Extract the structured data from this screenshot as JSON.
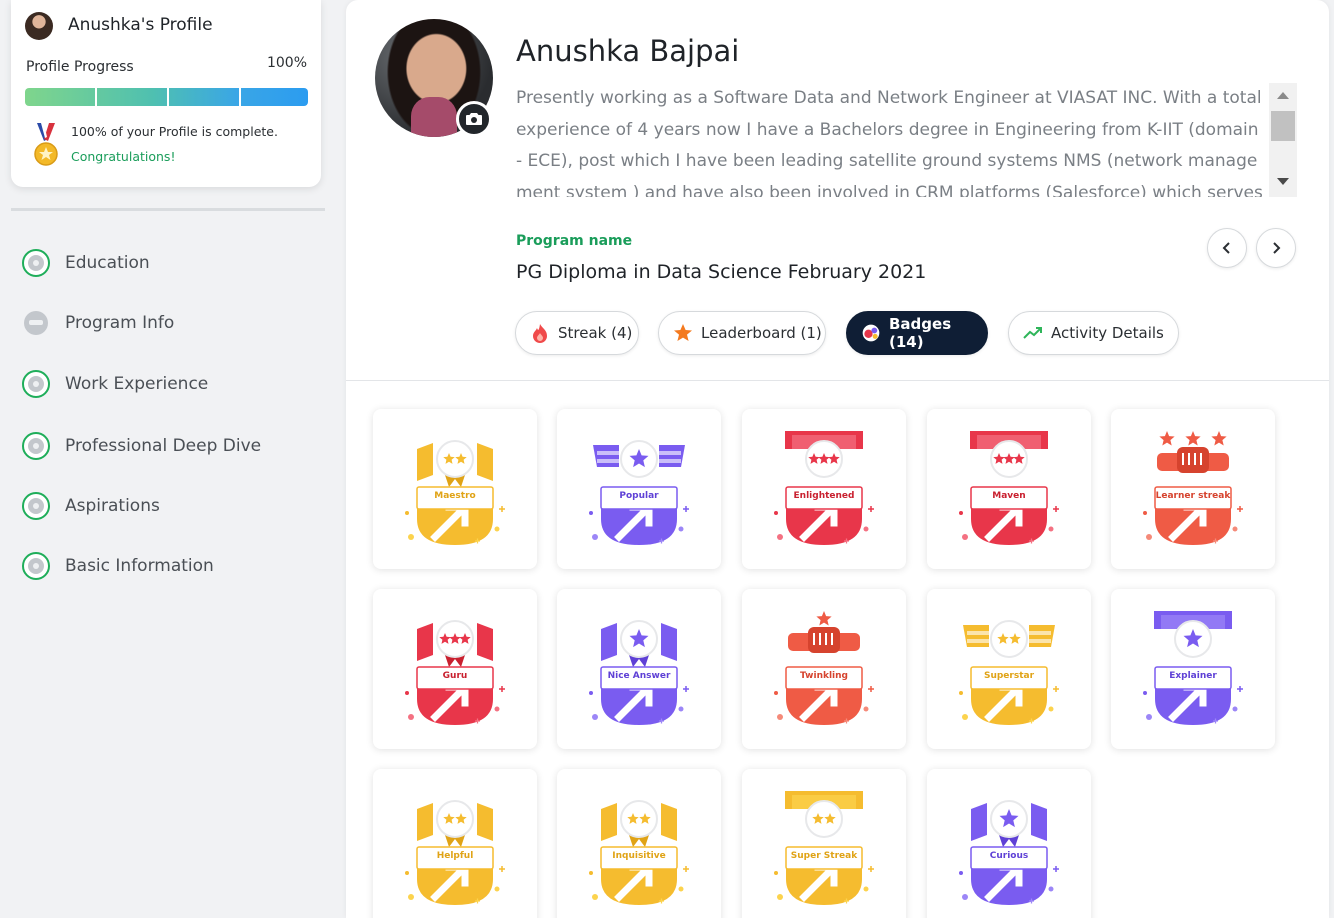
{
  "sidebar": {
    "profile_title": "Anushka's Profile",
    "progress_label": "Profile Progress",
    "progress_value": "100%",
    "progress_fraction": 1.0,
    "complete_msg": "100% of your Profile is complete.",
    "congrats_msg": "Congratulations!",
    "nav": [
      {
        "label": "Education",
        "icon": "education-icon"
      },
      {
        "label": "Program Info",
        "icon": "graduation-cap-icon"
      },
      {
        "label": "Work Experience",
        "icon": "gear-icon"
      },
      {
        "label": "Professional Deep Dive",
        "icon": "gear-icon"
      },
      {
        "label": "Aspirations",
        "icon": "target-icon"
      },
      {
        "label": "Basic Information",
        "icon": "gear-icon"
      }
    ]
  },
  "profile": {
    "name": "Anushka Bajpai",
    "bio": "Presently working as a Software Data and Network Engineer at VIASAT INC. With a total experience of 4 years now I have a Bachelors degree in Engineering from K-IIT (domain - ECE), post which I have been leading satellite ground systems NMS (network management system ) and have also been involved in CRM platforms (Salesforce) which serves as a dedicated",
    "program_label": "Program name",
    "program_name": "PG Diploma in Data Science February 2021"
  },
  "tabs": [
    {
      "label": "Streak (4)",
      "icon": "flame-icon",
      "active": false
    },
    {
      "label": "Leaderboard (1)",
      "icon": "star-icon",
      "active": false
    },
    {
      "label": "Badges (14)",
      "icon": "badges-icon",
      "active": true
    },
    {
      "label": "Activity Details",
      "icon": "trend-icon",
      "active": false
    }
  ],
  "colors": {
    "green": "#1a9d5a",
    "navy": "#0f1e35",
    "yellow": "#f5bc2f",
    "purple": "#7a5cf0",
    "red": "#e8364a",
    "orange": "#ef5b45"
  },
  "badges": [
    {
      "label": "Maestro",
      "color": "yellow",
      "stars": 2,
      "style": "scroll"
    },
    {
      "label": "Popular",
      "color": "purple",
      "stars": 1,
      "style": "wings"
    },
    {
      "label": "Enlightened",
      "color": "red",
      "stars": 3,
      "style": "banner"
    },
    {
      "label": "Maven",
      "color": "red",
      "stars": 3,
      "style": "banner"
    },
    {
      "label": "Learner streak",
      "color": "orange",
      "stars": 3,
      "style": "fist"
    },
    {
      "label": "Guru",
      "color": "red",
      "stars": 3,
      "style": "scroll"
    },
    {
      "label": "Nice Answer",
      "color": "purple",
      "stars": 1,
      "style": "scroll"
    },
    {
      "label": "Twinkling",
      "color": "orange",
      "stars": 1,
      "style": "fist"
    },
    {
      "label": "Superstar",
      "color": "yellow",
      "stars": 2,
      "style": "wings"
    },
    {
      "label": "Explainer",
      "color": "purple",
      "stars": 1,
      "style": "banner"
    },
    {
      "label": "Helpful",
      "color": "yellow",
      "stars": 2,
      "style": "scroll"
    },
    {
      "label": "Inquisitive",
      "color": "yellow",
      "stars": 2,
      "style": "scroll"
    },
    {
      "label": "Super Streak",
      "color": "yellow",
      "stars": 2,
      "style": "banner"
    },
    {
      "label": "Curious",
      "color": "purple",
      "stars": 1,
      "style": "scroll"
    }
  ]
}
